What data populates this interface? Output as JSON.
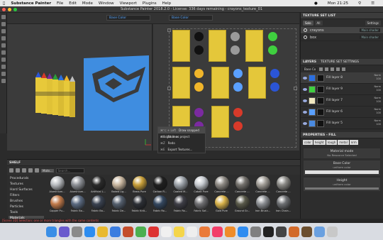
{
  "menubar": {
    "app": "Substance Painter",
    "items": [
      "File",
      "Edit",
      "Mode",
      "Window",
      "Viewport",
      "Plugins",
      "Help"
    ],
    "right": [
      "Mon 21:25"
    ]
  },
  "titlebar": {
    "title": "Substance Painter 2018.2.0 - License: 336 days remaining - crayons_texture_01"
  },
  "viewport": {
    "channel_3d": "Base Color",
    "channel_2d": "Base Color",
    "menu_items": [
      {
        "key": "⌘⌥ + Left",
        "label": "Draw snapped straight lines"
      },
      {
        "key": "⌘S",
        "label": "Save as project"
      },
      {
        "key": "⌘Z",
        "label": "Redo"
      },
      {
        "key": "⌘E",
        "label": "Export Textures..."
      }
    ]
  },
  "texture_set_list": {
    "header": "TEXTURE SET LIST",
    "tabs": [
      "Solo",
      "All"
    ],
    "settings": "Settings",
    "sets": [
      {
        "name": "crayons",
        "shader": "Main shader"
      },
      {
        "name": "box",
        "shader": "Main shader"
      }
    ]
  },
  "layers": {
    "tabs": [
      "LAYERS",
      "TEXTURE SET SETTINGS"
    ],
    "channel": "Base Co",
    "rows": [
      {
        "name": "Fill layer 8",
        "blend": "Norm",
        "opacity": "100",
        "color": "#2b6fe0"
      },
      {
        "name": "Fill layer 9",
        "blend": "Norm",
        "opacity": "100",
        "color": "#3fcf3f"
      },
      {
        "name": "Fill layer 7",
        "blend": "Norm",
        "opacity": "100",
        "color": "#f0e8c0"
      },
      {
        "name": "Fill layer 6",
        "blend": "Norm",
        "opacity": "100",
        "color": "#5aa0ff"
      },
      {
        "name": "Fill layer 5",
        "blend": "Norm",
        "opacity": "100",
        "color": "#4a8ae0"
      }
    ]
  },
  "properties": {
    "header": "PROPERTIES - FILL",
    "buttons": [
      "color",
      "height",
      "rough",
      "metal",
      "nrm"
    ],
    "material_mode": "Material mode",
    "no_resource": "No Resource Selected",
    "base_color": "Base Color",
    "base_sub": "uniform color",
    "height": "Height",
    "height_sub": "uniform color"
  },
  "shelf": {
    "header": "SHELF",
    "filter_tag": "Mate...",
    "search_placeholder": "Search...",
    "categories": [
      "Procedurals",
      "Textures",
      "Hard Surfaces",
      "Filters",
      "Brushes",
      "Particles",
      "Tools",
      "Materials"
    ],
    "materials": [
      {
        "name": "Aluminium...",
        "color": "#b9bcc0"
      },
      {
        "name": "Aluminium...",
        "color": "#8d9096"
      },
      {
        "name": "Artificial L...",
        "color": "#2a2a2a"
      },
      {
        "name": "Baked Lig...",
        "color": "#c9b7a0"
      },
      {
        "name": "Brass Pure",
        "color": "#c9a03a"
      },
      {
        "name": "Carbon Fi...",
        "color": "#1f1f1f"
      },
      {
        "name": "Coated M...",
        "color": "#9da3aa"
      },
      {
        "name": "Cobalt Pure",
        "color": "#c7cbd0"
      },
      {
        "name": "Concrete ...",
        "color": "#8f8b85"
      },
      {
        "name": "Concrete ...",
        "color": "#75726d"
      },
      {
        "name": "Concrete ...",
        "color": "#a29e97"
      },
      {
        "name": "Concrete ...",
        "color": "#8b8a86"
      },
      {
        "name": "Copper Pu...",
        "color": "#c27b4b"
      },
      {
        "name": "Fabric Ba...",
        "color": "#5b6a80"
      },
      {
        "name": "Fabric Ba...",
        "color": "#3a4250"
      },
      {
        "name": "Fabric De...",
        "color": "#55606e"
      },
      {
        "name": "Fabric Knit...",
        "color": "#2c2f35"
      },
      {
        "name": "Fabric Ro...",
        "color": "#34475f"
      },
      {
        "name": "Fabric Ro...",
        "color": "#3e3e46"
      },
      {
        "name": "Fabric Sof...",
        "color": "#6f6f72"
      },
      {
        "name": "Gold Pure",
        "color": "#d9b34a"
      },
      {
        "name": "Ground Gr...",
        "color": "#5a5a4a"
      },
      {
        "name": "Iron Brush...",
        "color": "#8c8f93"
      },
      {
        "name": "Iron Chain...",
        "color": "#6d6f72"
      }
    ]
  },
  "status": {
    "message": "[Scene 3D] Selection: one or more triangles with the same contents"
  },
  "dock": {
    "icons": [
      {
        "name": "finder-icon",
        "color": "#3a8ee6"
      },
      {
        "name": "siri-icon",
        "color": "#6a5acd"
      },
      {
        "name": "launchpad-icon",
        "color": "#8a8a8a"
      },
      {
        "name": "safari-icon",
        "color": "#2d8cf0"
      },
      {
        "name": "chrome-icon",
        "color": "#e9b92f"
      },
      {
        "name": "mail-icon",
        "color": "#3b7de0"
      },
      {
        "name": "substance-icon",
        "color": "#c44d2c"
      },
      {
        "name": "maps-icon",
        "color": "#4caf50"
      },
      {
        "name": "substance-s-icon",
        "color": "#d33"
      },
      {
        "name": "calendar-icon",
        "color": "#f0f0f0"
      },
      {
        "name": "notes-icon",
        "color": "#f4d54a"
      },
      {
        "name": "reminders-icon",
        "color": "#eeeeee"
      },
      {
        "name": "photos-icon",
        "color": "#ea7a3a"
      },
      {
        "name": "music-icon",
        "color": "#f23f6a"
      },
      {
        "name": "books-icon",
        "color": "#ef8c2a"
      },
      {
        "name": "appstore-icon",
        "color": "#2f8cf0"
      },
      {
        "name": "preferences-icon",
        "color": "#808080"
      },
      {
        "name": "terminal-icon",
        "color": "#222"
      },
      {
        "name": "activity-icon",
        "color": "#444"
      },
      {
        "name": "butterfly-icon",
        "color": "#d26a2a"
      },
      {
        "name": "app-icon",
        "color": "#6b4e2e"
      },
      {
        "name": "downloads-icon",
        "color": "#6aa0e0"
      },
      {
        "name": "trash-icon",
        "color": "#c8c8c8"
      }
    ]
  }
}
